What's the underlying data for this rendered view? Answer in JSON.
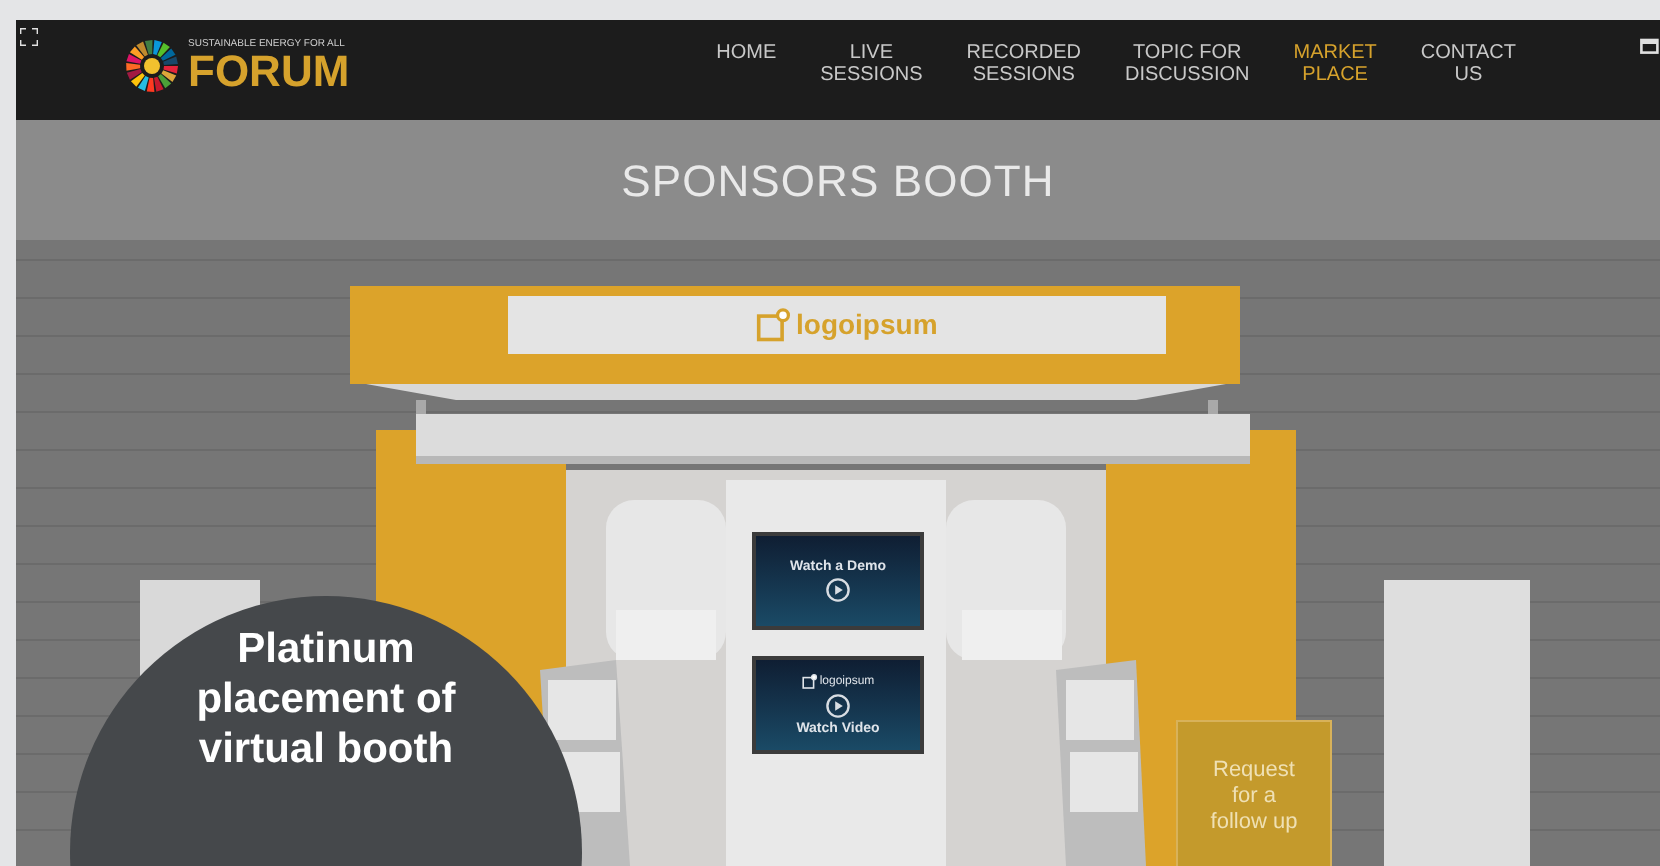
{
  "logo": {
    "tagline": "SUSTAINABLE ENERGY FOR ALL",
    "name": "FORUM"
  },
  "nav": [
    {
      "label": "HOME",
      "selected": false
    },
    {
      "label": "LIVE\nSESSIONS",
      "selected": false
    },
    {
      "label": "RECORDED\nSESSIONS",
      "selected": false
    },
    {
      "label": "TOPIC FOR\nDISCUSSION",
      "selected": false
    },
    {
      "label": "MARKET\nPLACE",
      "selected": true
    },
    {
      "label": "CONTACT\nUS",
      "selected": false
    }
  ],
  "page_title": "SPONSORS BOOTH",
  "booth": {
    "sign_logo": "logoipsum",
    "screens": [
      {
        "kind": "demo",
        "title": "Watch a Demo"
      },
      {
        "kind": "video",
        "brand": "logoipsum",
        "title": "Watch Video"
      }
    ],
    "follow_up_sign": "Request\nfor a\nfollow up"
  },
  "callout": "Platinum placement of virtual booth"
}
